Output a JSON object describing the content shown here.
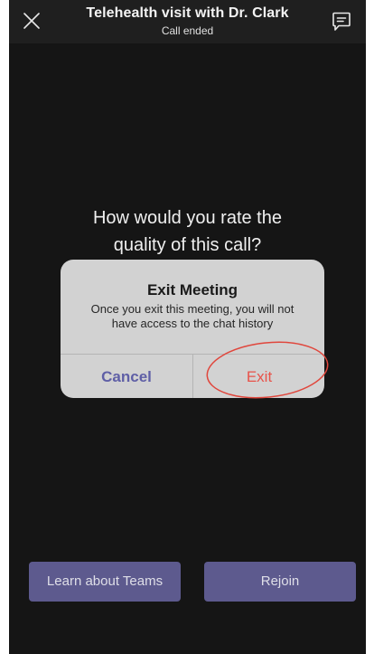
{
  "header": {
    "title": "Telehealth visit with Dr. Clark",
    "subtitle": "Call ended"
  },
  "rating_prompt": {
    "line1": "How would you rate the",
    "line2": "quality of this call?"
  },
  "dialog": {
    "title": "Exit Meeting",
    "message_line1": "Once you exit this meeting, you will not",
    "message_line2": "have access to the chat history",
    "cancel_label": "Cancel",
    "exit_label": "Exit"
  },
  "actions": {
    "learn_label": "Learn about Teams",
    "rejoin_label": "Rejoin"
  },
  "colors": {
    "accent": "#5d5a8e",
    "cancel": "#5f5fa6",
    "exit": "#e8534a",
    "annotation": "#e0463c"
  },
  "icons": {
    "close": "close-icon",
    "chat": "chat-icon"
  }
}
